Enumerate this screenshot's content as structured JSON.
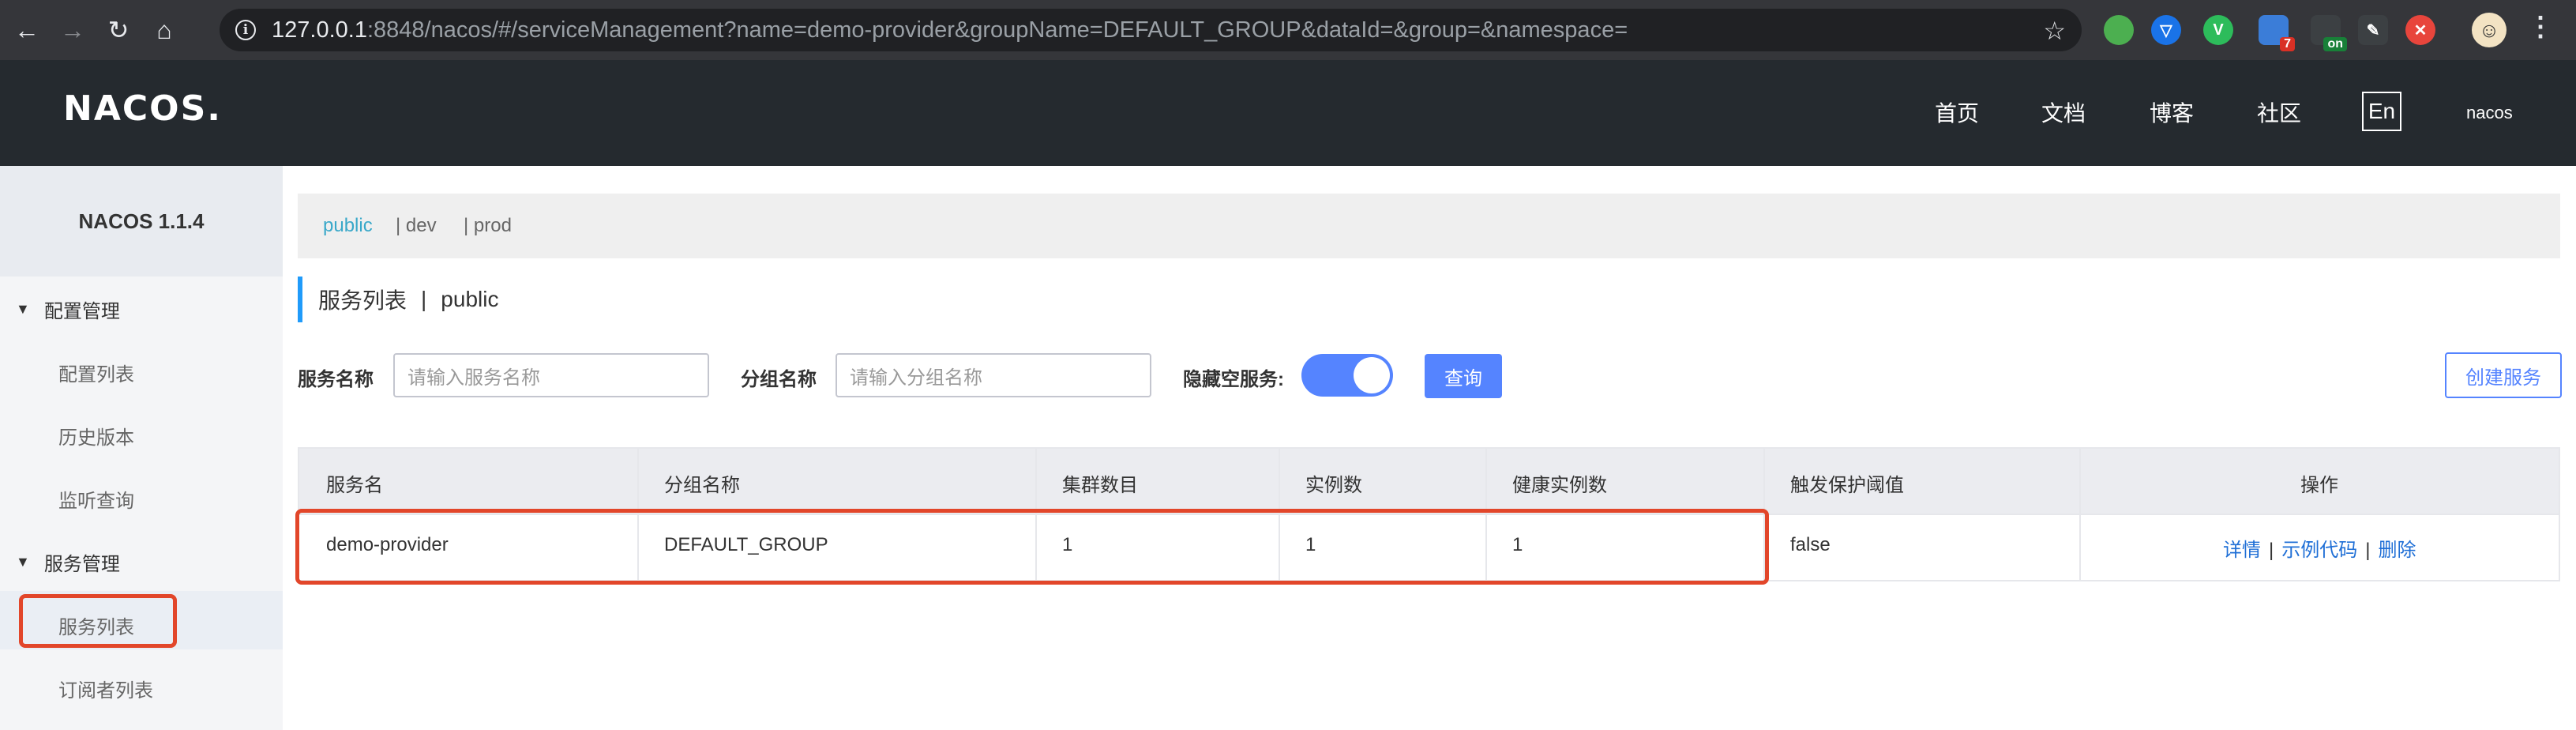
{
  "browser": {
    "url_host": "127.0.0.1",
    "url_rest": ":8848/nacos/#/serviceManagement?name=demo-provider&groupName=DEFAULT_GROUP&dataId=&group=&namespace=",
    "extensions": [
      {
        "name": "green-dot-ext",
        "color": "#4caf50",
        "text": ""
      },
      {
        "name": "vpn-shield-ext",
        "color": "#1a73e8",
        "text": "▽"
      },
      {
        "name": "vue-devtools-ext",
        "color": "#2dbc5b",
        "text": "V"
      },
      {
        "name": "tab-manager-ext",
        "color": "#3b7dd8",
        "text": "",
        "badge": "7",
        "badge_color": "#d93025"
      },
      {
        "name": "switch-ext",
        "color": "#3c4043",
        "text": "",
        "badge": "on",
        "badge_color": "#188038"
      },
      {
        "name": "color-picker-ext",
        "color": "#3c4043",
        "text": "✎"
      },
      {
        "name": "red-ext",
        "color": "#e8453c",
        "text": "✕"
      }
    ]
  },
  "header": {
    "logo": "NACOS.",
    "nav": [
      "首页",
      "文档",
      "博客",
      "社区"
    ],
    "lang": "En",
    "user": "nacos"
  },
  "sidebar": {
    "title": "NACOS 1.1.4",
    "groups": [
      {
        "label": "配置管理",
        "items": [
          "配置列表",
          "历史版本",
          "监听查询"
        ]
      },
      {
        "label": "服务管理",
        "items": [
          "服务列表",
          "订阅者列表"
        ]
      }
    ]
  },
  "namespaces": [
    "public",
    "| dev",
    "| prod"
  ],
  "page": {
    "title": "服务列表",
    "divider": "|",
    "namespace": "public"
  },
  "filters": {
    "service_label": "服务名称",
    "service_placeholder": "请输入服务名称",
    "group_label": "分组名称",
    "group_placeholder": "请输入分组名称",
    "hide_empty_label": "隐藏空服务:",
    "hide_empty_on": true,
    "query_label": "查询",
    "create_label": "创建服务"
  },
  "table": {
    "columns": [
      "服务名",
      "分组名称",
      "集群数目",
      "实例数",
      "健康实例数",
      "触发保护阈值",
      "操作"
    ],
    "rows": [
      {
        "service": "demo-provider",
        "group": "DEFAULT_GROUP",
        "clusters": "1",
        "instances": "1",
        "healthy": "1",
        "threshold": "false",
        "actions": [
          "详情",
          "示例代码",
          "删除"
        ]
      }
    ]
  },
  "colors": {
    "accent": "#5584ff",
    "highlight": "#e2462a",
    "header_bg": "#252a2f",
    "active_ns": "#39a8c9"
  }
}
